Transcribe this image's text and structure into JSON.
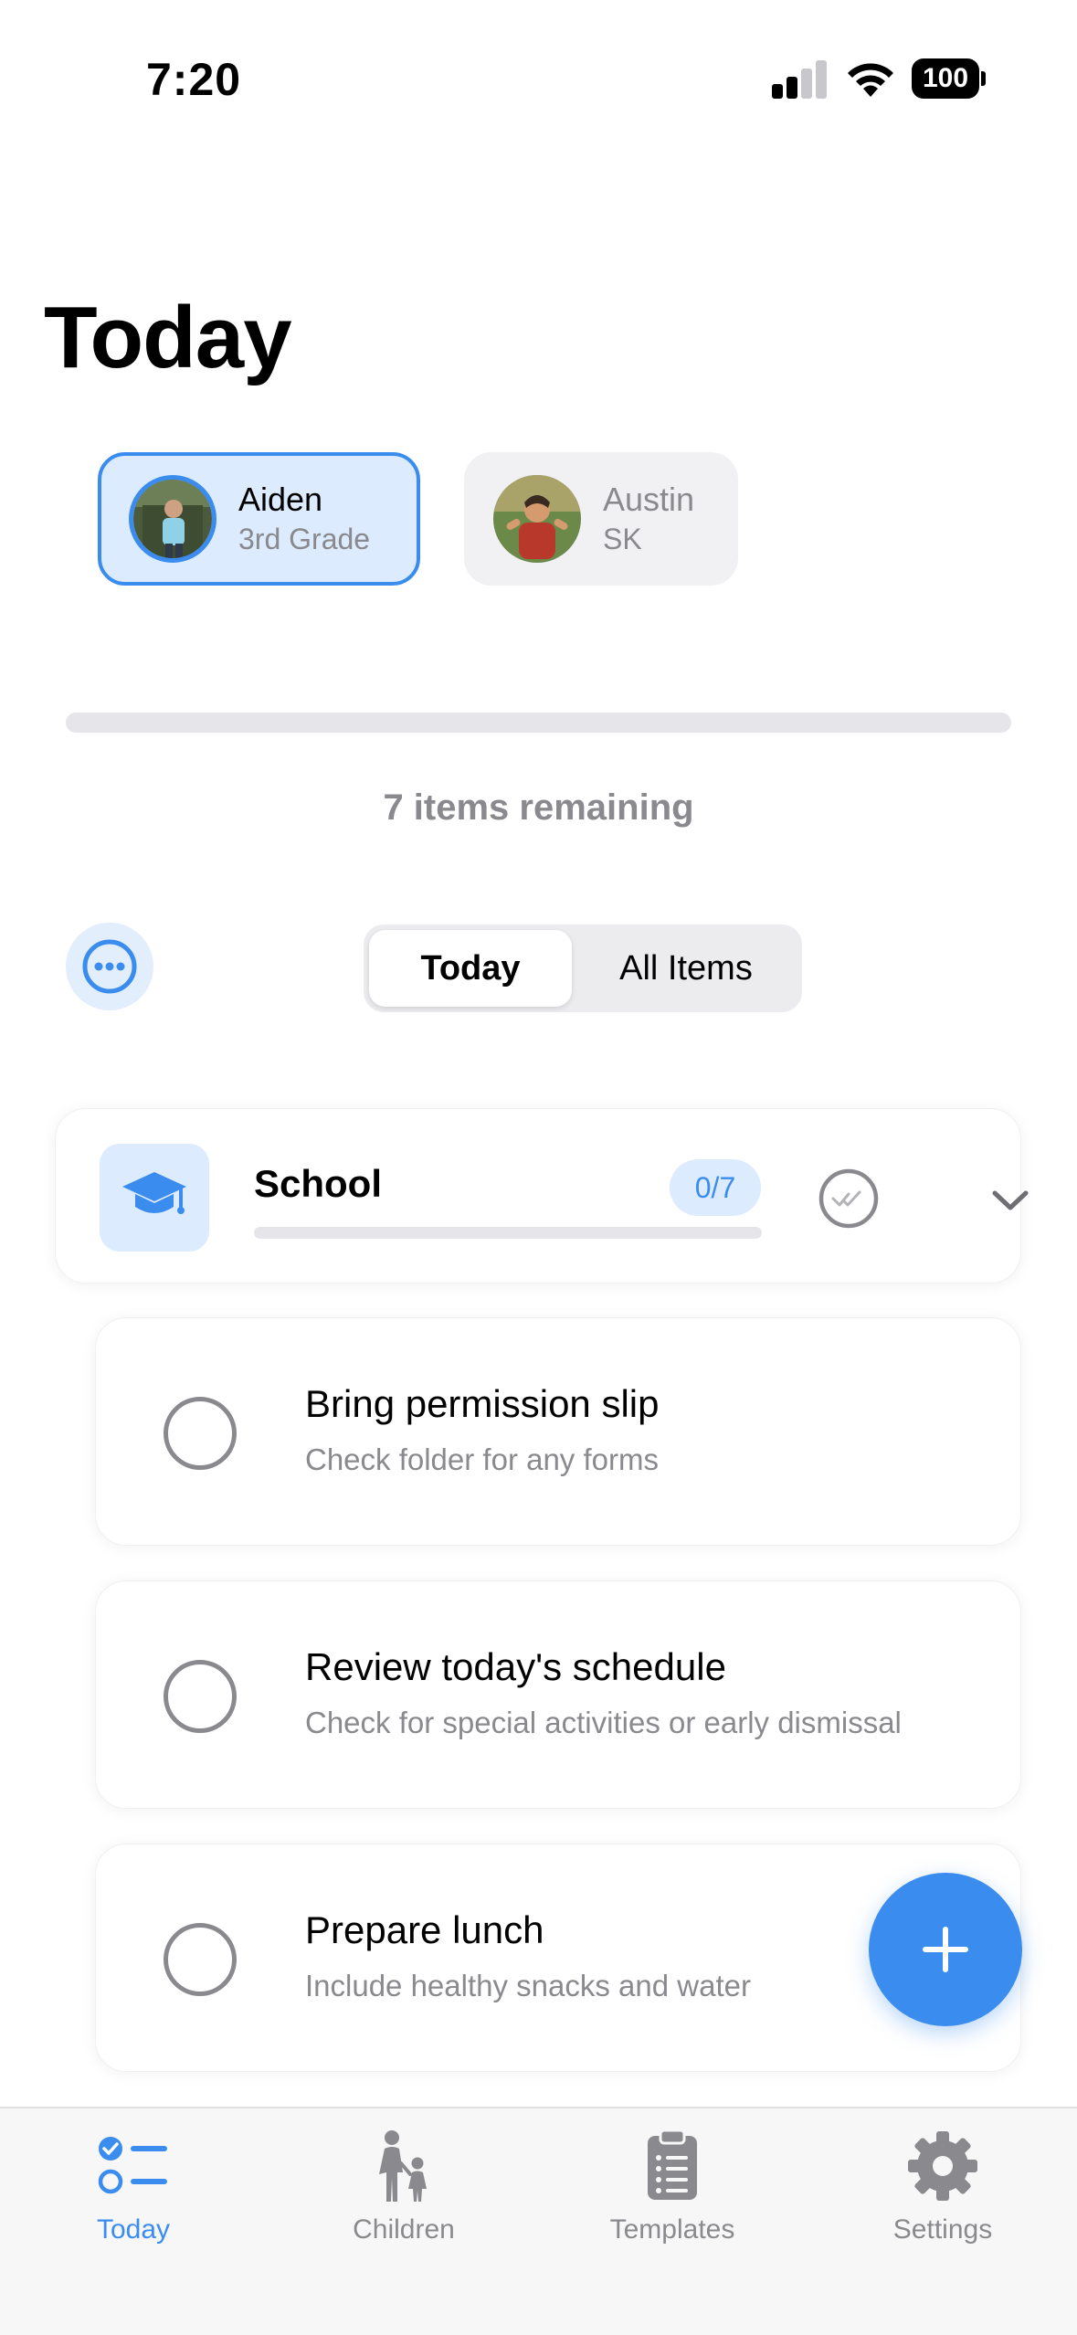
{
  "status_bar": {
    "time": "7:20",
    "battery": "100"
  },
  "page_title": "Today",
  "children": [
    {
      "name": "Aiden",
      "grade": "3rd Grade",
      "selected": true
    },
    {
      "name": "Austin",
      "grade": "SK",
      "selected": false
    }
  ],
  "progress": {
    "completed_fraction": 0,
    "remaining_text": "7 items remaining"
  },
  "segmented": {
    "options": [
      "Today",
      "All Items"
    ],
    "selected": "Today"
  },
  "category": {
    "icon": "graduation-cap-icon",
    "title": "School",
    "badge": "0/7",
    "progress_fraction": 0
  },
  "tasks": [
    {
      "title": "Bring permission slip",
      "subtitle": "Check folder for any forms",
      "done": false
    },
    {
      "title": "Review today's schedule",
      "subtitle": "Check for special activities or early dismissal",
      "done": false
    },
    {
      "title": "Prepare lunch",
      "subtitle": "Include healthy snacks and water",
      "done": false
    }
  ],
  "tabbar": [
    {
      "label": "Today",
      "icon": "checklist-icon",
      "active": true
    },
    {
      "label": "Children",
      "icon": "parent-child-icon",
      "active": false
    },
    {
      "label": "Templates",
      "icon": "clipboard-icon",
      "active": false
    },
    {
      "label": "Settings",
      "icon": "gear-icon",
      "active": false
    }
  ],
  "colors": {
    "accent": "#3b8cef",
    "accent_light": "#dcebfd",
    "muted": "#8a8a8e"
  }
}
